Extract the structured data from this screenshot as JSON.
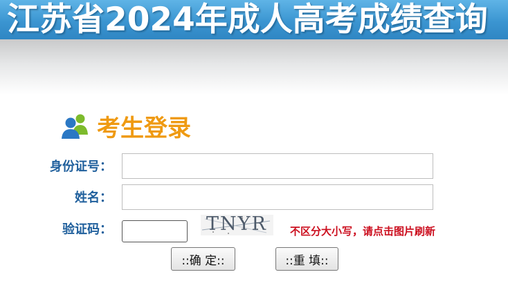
{
  "header": {
    "title": "江苏省2024年成人高考成绩查询"
  },
  "login": {
    "heading": "考生登录",
    "id_label": "身份证号：",
    "id_value": "",
    "name_label": "姓名：",
    "name_value": "",
    "code_label": "验证码：",
    "code_value": "",
    "captcha_text": "TNYR",
    "captcha_hint": "不区分大小写，请点击图片刷新",
    "submit_label": "::确 定::",
    "reset_label": "::重 填::"
  },
  "colors": {
    "banner": "#3b95d1",
    "heading": "#ef9a12",
    "label": "#1f5f9c",
    "hint": "#cc0f1f"
  },
  "icons": {
    "login_icon": "users-icon"
  }
}
